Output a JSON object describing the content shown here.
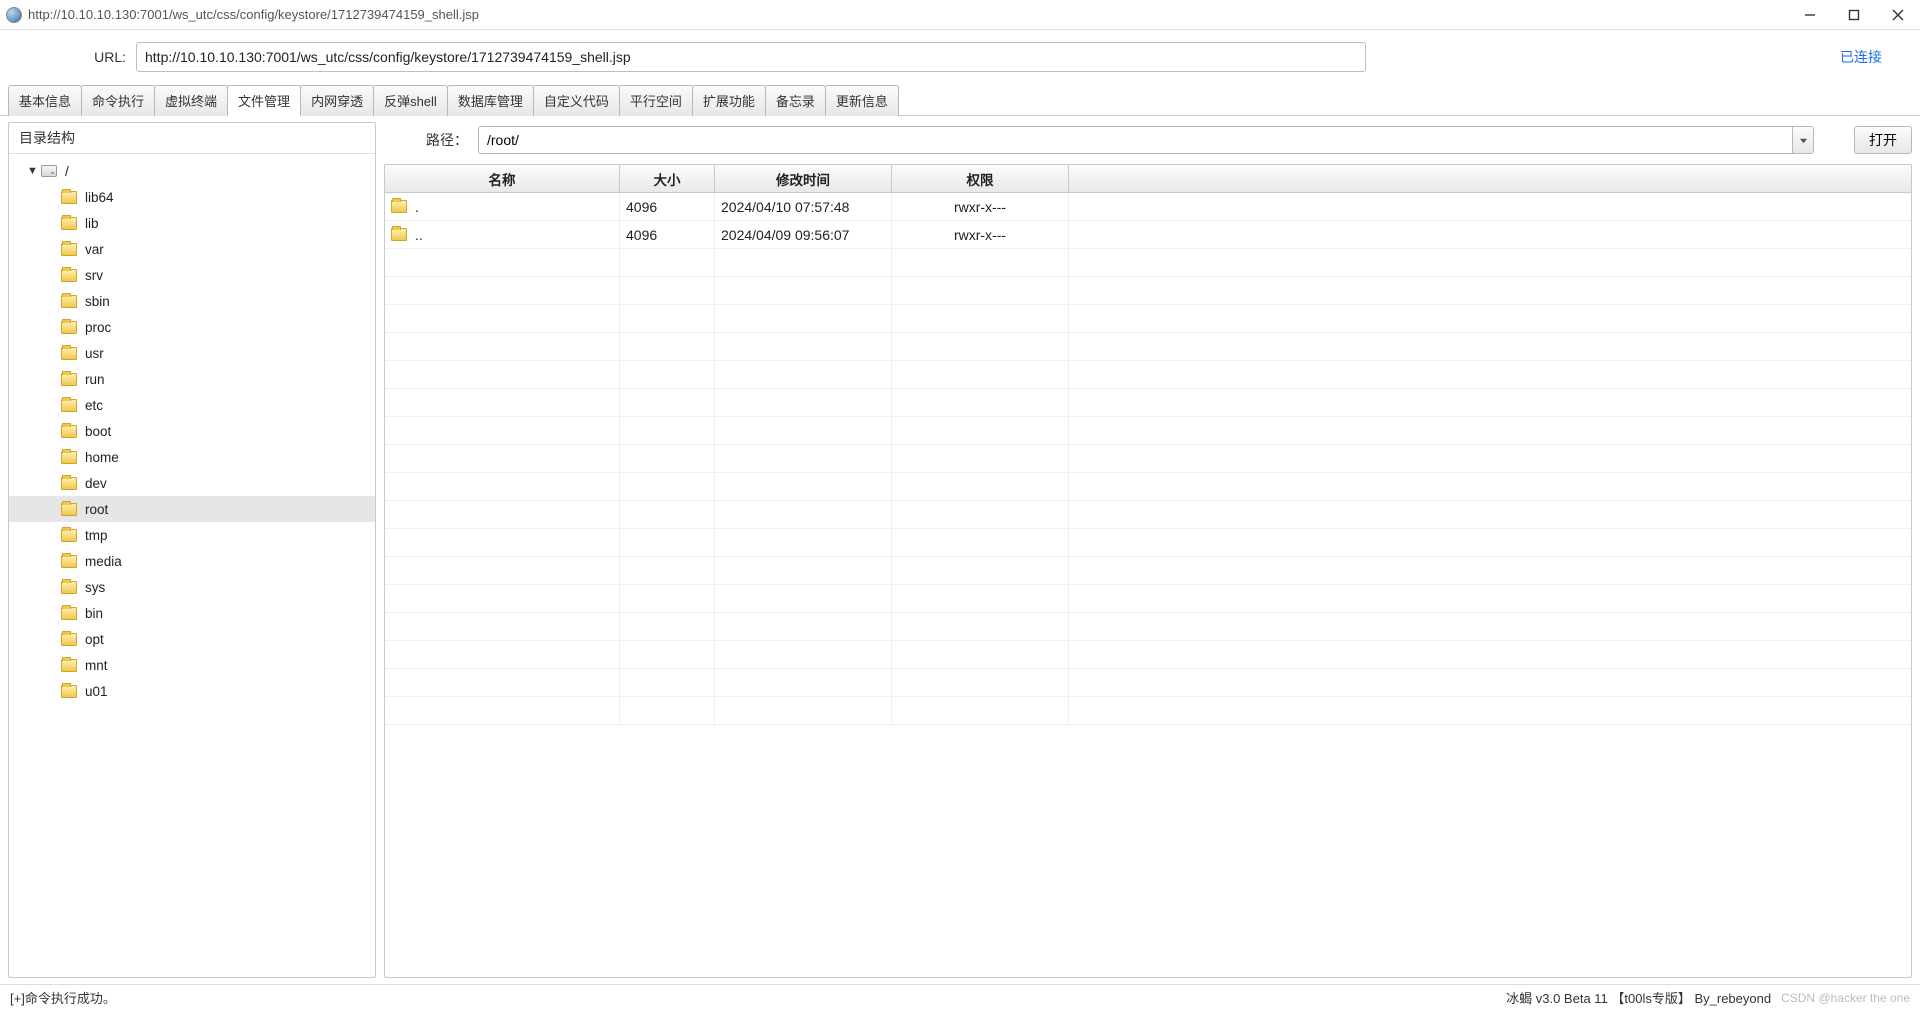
{
  "titlebar": {
    "title": "http://10.10.10.130:7001/ws_utc/css/config/keystore/1712739474159_shell.jsp"
  },
  "urlbar": {
    "label": "URL:",
    "value": "http://10.10.10.130:7001/ws_utc/css/config/keystore/1712739474159_shell.jsp",
    "status": "已连接"
  },
  "tabs": [
    "基本信息",
    "命令执行",
    "虚拟终端",
    "文件管理",
    "内网穿透",
    "反弹shell",
    "数据库管理",
    "自定义代码",
    "平行空间",
    "扩展功能",
    "备忘录",
    "更新信息"
  ],
  "active_tab_index": 3,
  "sidebar": {
    "header": "目录结构",
    "root_label": "/",
    "items": [
      "lib64",
      "lib",
      "var",
      "srv",
      "sbin",
      "proc",
      "usr",
      "run",
      "etc",
      "boot",
      "home",
      "dev",
      "root",
      "tmp",
      "media",
      "sys",
      "bin",
      "opt",
      "mnt",
      "u01"
    ],
    "selected_index": 12
  },
  "path": {
    "label": "路径：",
    "value": "/root/",
    "open_label": "打开"
  },
  "filetable": {
    "headers": {
      "name": "名称",
      "size": "大小",
      "date": "修改时间",
      "perm": "权限"
    },
    "rows": [
      {
        "name": ".",
        "size": "4096",
        "date": "2024/04/10 07:57:48",
        "perm": "rwxr-x---"
      },
      {
        "name": "..",
        "size": "4096",
        "date": "2024/04/09 09:56:07",
        "perm": "rwxr-x---"
      }
    ],
    "empty_rows": 17
  },
  "statusbar": {
    "left": "[+]命令执行成功。",
    "right": "冰蝎 v3.0 Beta 11 【t00ls专版】  By_rebeyond",
    "watermark": "CSDN @hacker the one"
  }
}
